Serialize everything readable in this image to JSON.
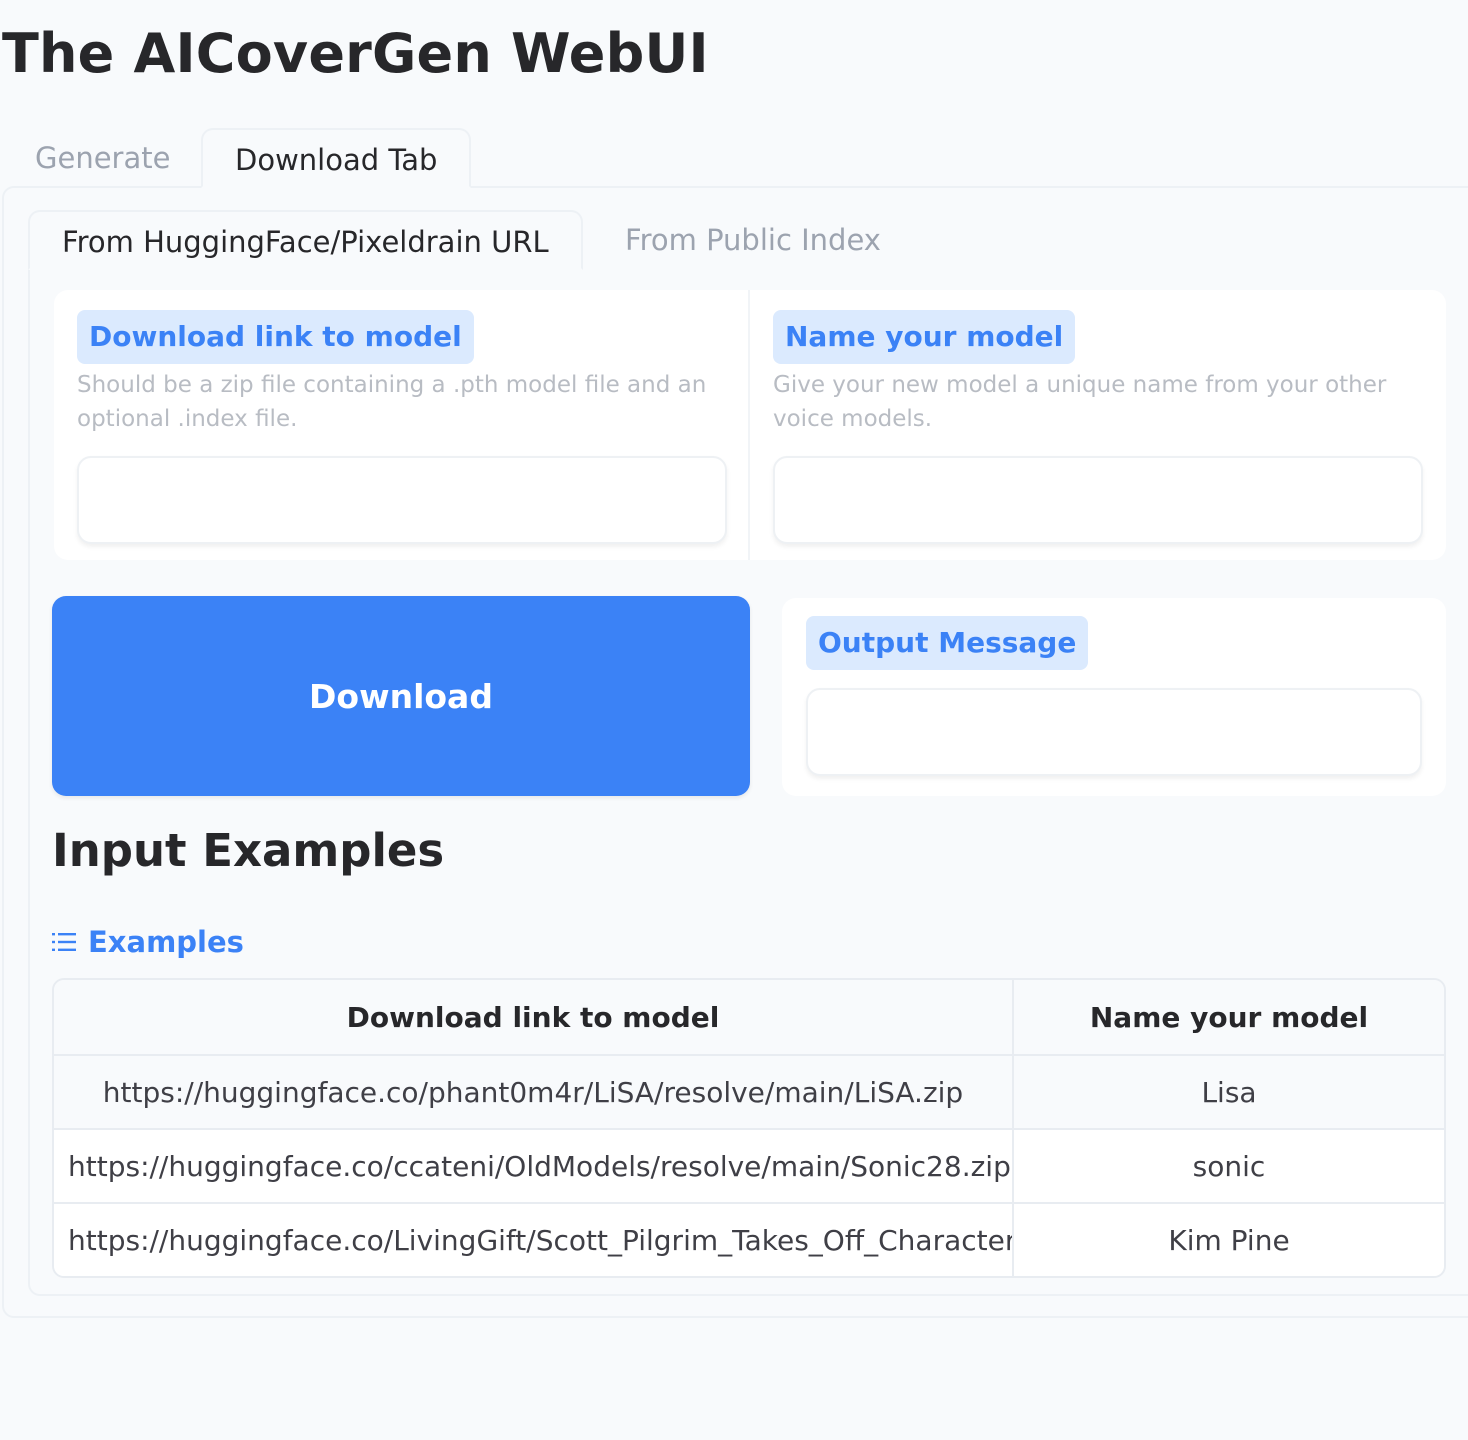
{
  "app": {
    "title": "The AICoverGen WebUI"
  },
  "tabs": [
    {
      "label": "Generate",
      "active": false
    },
    {
      "label": "Download Tab",
      "active": true
    }
  ],
  "subtabs": [
    {
      "label": "From HuggingFace/Pixeldrain URL",
      "active": true
    },
    {
      "label": "From Public Index",
      "active": false
    }
  ],
  "form": {
    "link": {
      "label": "Download link to model",
      "info": "Should be a zip file containing a .pth model file and an optional .index file.",
      "value": ""
    },
    "name": {
      "label": "Name your model",
      "info": "Give your new model a unique name from your other voice models.",
      "value": ""
    },
    "download_button": "Download",
    "output": {
      "label": "Output Message",
      "value": ""
    }
  },
  "examples": {
    "heading": "Input Examples",
    "label": "Examples",
    "icon": "list-icon",
    "columns": [
      "Download link to model",
      "Name your model"
    ],
    "rows": [
      {
        "link": "https://huggingface.co/phant0m4r/LiSA/resolve/main/LiSA.zip",
        "name": "Lisa"
      },
      {
        "link": "https://huggingface.co/ccateni/OldModels/resolve/main/Sonic28.zip",
        "name": "sonic"
      },
      {
        "link": "https://huggingface.co/LivingGift/Scott_Pilgrim_Takes_Off_Characters",
        "name": "Kim Pine"
      }
    ]
  },
  "colors": {
    "accent": "#3b82f6",
    "label_bg": "#dbeafe",
    "page_bg": "#f8fafc"
  }
}
